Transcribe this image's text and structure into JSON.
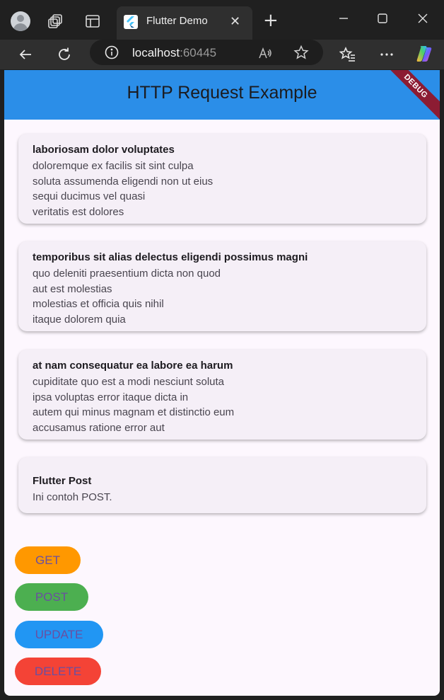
{
  "browser": {
    "tab_title": "Flutter Demo",
    "url_host": "localhost",
    "url_port": ":60445"
  },
  "app": {
    "appbar_title": "HTTP Request Example",
    "debug_banner": "DEBUG",
    "posts": [
      {
        "title": "laboriosam dolor voluptates",
        "body": "doloremque ex facilis sit sint culpa\nsoluta assumenda eligendi non ut eius\nsequi ducimus vel quasi\nveritatis est dolores"
      },
      {
        "title": "temporibus sit alias delectus eligendi possimus magni",
        "body": "quo deleniti praesentium dicta non quod\naut est molestias\nmolestias et officia quis nihil\nitaque dolorem quia"
      },
      {
        "title": "at nam consequatur ea labore ea harum",
        "body": "cupiditate quo est a modi nesciunt soluta\nipsa voluptas error itaque dicta in\nautem qui minus magnam et distinctio eum\naccusamus ratione error aut"
      },
      {
        "title": "Flutter Post",
        "body": "Ini contoh POST."
      }
    ],
    "buttons": {
      "get": "GET",
      "post": "POST",
      "update": "UPDATE",
      "delete": "DELETE"
    }
  },
  "colors": {
    "appbar": "#2b8ee8",
    "get_button": "#ff9800",
    "post_button": "#4caf50",
    "update_button": "#2196f3",
    "delete_button": "#f44336",
    "debug_banner": "#8c1c33"
  },
  "icons": [
    "profile-icon",
    "workspaces-icon",
    "tab-actions-icon",
    "flutter-favicon",
    "close-icon",
    "new-tab-icon",
    "minimize-icon",
    "maximize-icon",
    "window-close-icon",
    "back-icon",
    "refresh-icon",
    "site-info-icon",
    "read-aloud-icon",
    "favorite-star-icon",
    "favorites-icon",
    "more-icon",
    "copilot-icon"
  ]
}
